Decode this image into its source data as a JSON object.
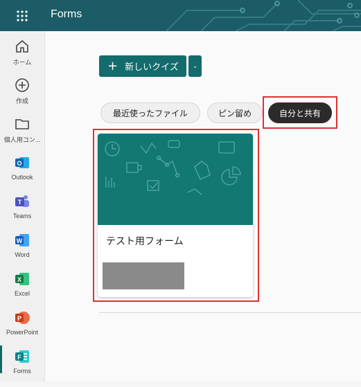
{
  "app": {
    "title": "Forms"
  },
  "rail": {
    "items": [
      {
        "label": "ホーム",
        "icon": "home-icon"
      },
      {
        "label": "作成",
        "icon": "create-icon"
      },
      {
        "label": "個人用コン...",
        "icon": "folder-icon"
      },
      {
        "label": "Outlook",
        "icon": "outlook-icon"
      },
      {
        "label": "Teams",
        "icon": "teams-icon"
      },
      {
        "label": "Word",
        "icon": "word-icon"
      },
      {
        "label": "Excel",
        "icon": "excel-icon"
      },
      {
        "label": "PowerPoint",
        "icon": "powerpoint-icon"
      },
      {
        "label": "Forms",
        "icon": "forms-icon"
      }
    ]
  },
  "toolbar": {
    "new_quiz_label": "新しいクイズ"
  },
  "filters": [
    {
      "label": "最近使ったファイル",
      "selected": false
    },
    {
      "label": "ピン留め",
      "selected": false
    },
    {
      "label": "自分と共有",
      "selected": true
    }
  ],
  "cards": [
    {
      "title": "テスト用フォーム"
    }
  ],
  "colors": {
    "brand": "#136b6c",
    "header": "#1b5c67",
    "highlight": "#e03030"
  }
}
